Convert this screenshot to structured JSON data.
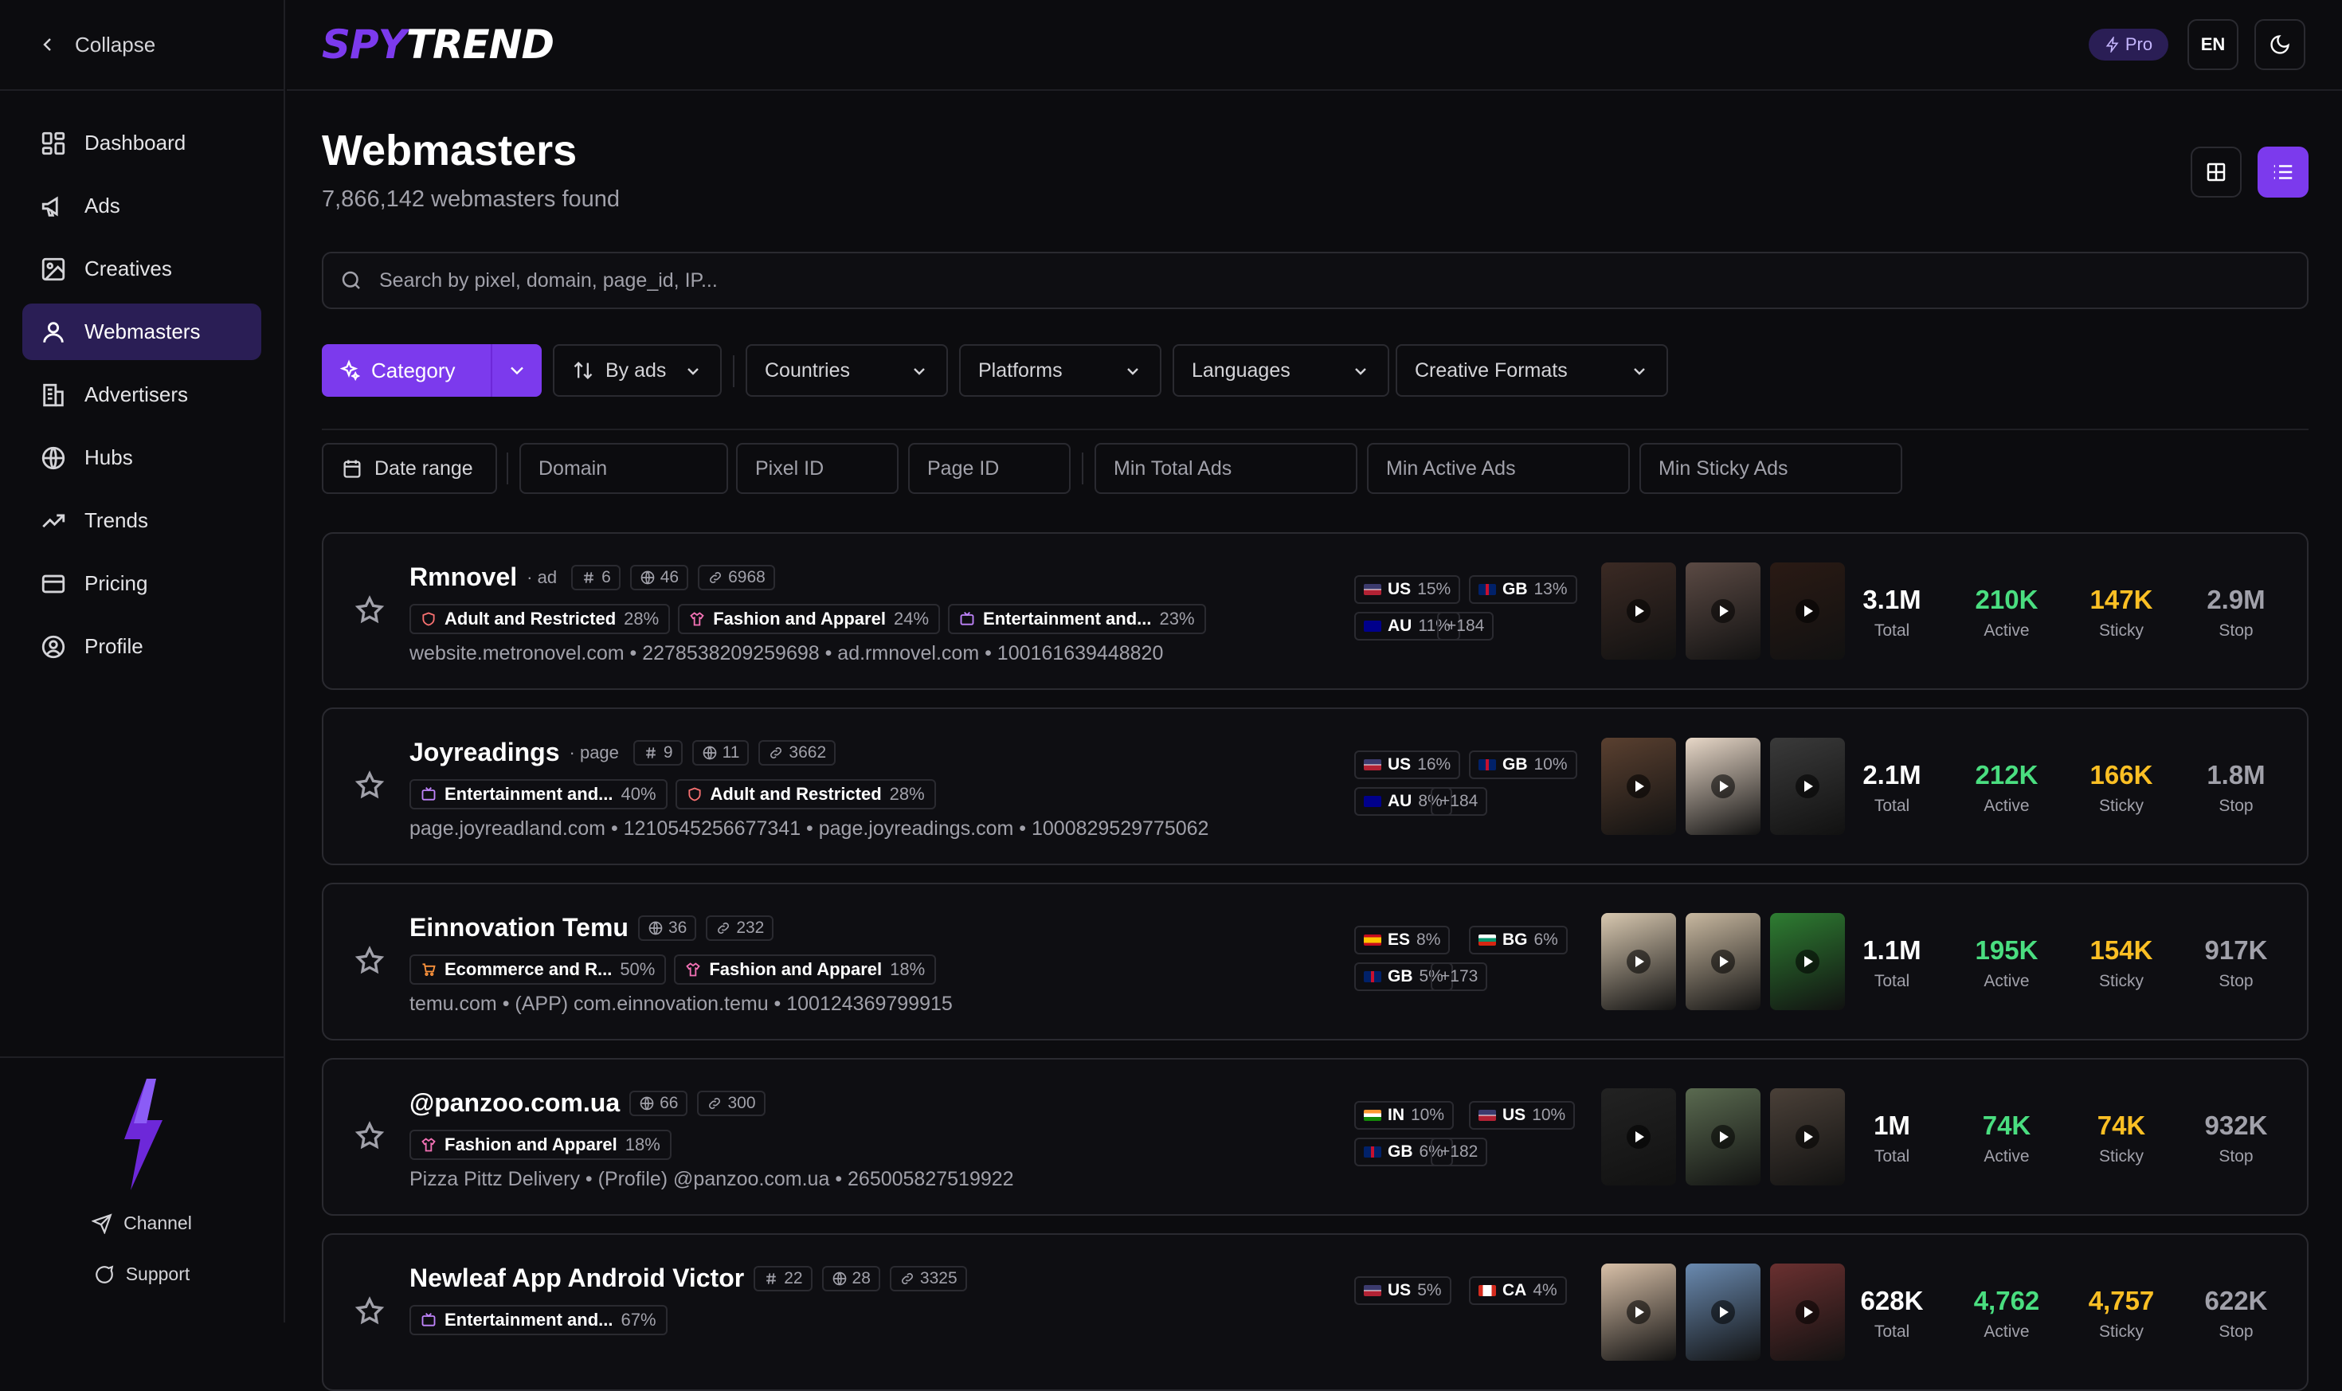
{
  "sidebar": {
    "collapse_label": "Collapse",
    "items": [
      {
        "label": "Dashboard",
        "icon": "dashboard-icon"
      },
      {
        "label": "Ads",
        "icon": "megaphone-icon"
      },
      {
        "label": "Creatives",
        "icon": "image-icon"
      },
      {
        "label": "Webmasters",
        "icon": "user-icon",
        "active": true
      },
      {
        "label": "Advertisers",
        "icon": "building-icon"
      },
      {
        "label": "Hubs",
        "icon": "globe-icon"
      },
      {
        "label": "Trends",
        "icon": "trending-icon"
      },
      {
        "label": "Pricing",
        "icon": "card-icon"
      },
      {
        "label": "Profile",
        "icon": "user-circle-icon"
      }
    ],
    "channel_label": "Channel",
    "support_label": "Support"
  },
  "header": {
    "logo_a": "SPY",
    "logo_b": "TREND",
    "pro_label": "Pro",
    "lang_label": "EN"
  },
  "page": {
    "title": "Webmasters",
    "subtitle": "7,866,142 webmasters found",
    "search_placeholder": "Search by pixel, domain, page_id, IP..."
  },
  "filters": {
    "category": "Category",
    "sort": "By ads",
    "countries": "Countries",
    "platforms": "Platforms",
    "languages": "Languages",
    "formats": "Creative Formats",
    "date_range": "Date range",
    "domain_ph": "Domain",
    "pixel_ph": "Pixel ID",
    "page_ph": "Page ID",
    "min_total_ph": "Min Total Ads",
    "min_active_ph": "Min Active Ads",
    "min_sticky_ph": "Min Sticky Ads"
  },
  "metric_labels": {
    "total": "Total",
    "active": "Active",
    "sticky": "Sticky",
    "stop": "Stop"
  },
  "colors": {
    "accent": "#7c3aed",
    "active": "#4ade80",
    "sticky": "#fbbf24",
    "stop": "#a1a1aa"
  },
  "cards": [
    {
      "name": "Rmnovel",
      "type": "· ad",
      "stats": [
        {
          "icon": "hash-icon",
          "v": "6"
        },
        {
          "icon": "globe-icon",
          "v": "46"
        },
        {
          "icon": "link-icon",
          "v": "6968"
        }
      ],
      "tags": [
        {
          "icon": "shield-icon",
          "label": "Adult and Restricted",
          "pct": "28%",
          "color": "#f87171"
        },
        {
          "icon": "shirt-icon",
          "label": "Fashion and Apparel",
          "pct": "24%",
          "color": "#f472b6"
        },
        {
          "icon": "tv-icon",
          "label": "Entertainment and...",
          "pct": "23%",
          "color": "#c084fc"
        }
      ],
      "meta": "website.metronovel.com • 2278538209259698 • ad.rmnovel.com • 100161639448820",
      "geo": [
        {
          "c": "US",
          "p": "15%"
        },
        {
          "c": "GB",
          "p": "13%"
        },
        {
          "c": "AU",
          "p": "11%"
        }
      ],
      "more": "+184",
      "total": "3.1M",
      "active": "210K",
      "sticky": "147K",
      "stop": "2.9M"
    },
    {
      "name": "Joyreadings",
      "type": "· page",
      "stats": [
        {
          "icon": "hash-icon",
          "v": "9"
        },
        {
          "icon": "globe-icon",
          "v": "11"
        },
        {
          "icon": "link-icon",
          "v": "3662"
        }
      ],
      "tags": [
        {
          "icon": "tv-icon",
          "label": "Entertainment and...",
          "pct": "40%",
          "color": "#c084fc"
        },
        {
          "icon": "shield-icon",
          "label": "Adult and Restricted",
          "pct": "28%",
          "color": "#f87171"
        }
      ],
      "meta": "page.joyreadland.com • 1210545256677341 • page.joyreadings.com • 1000829529775062",
      "geo": [
        {
          "c": "US",
          "p": "16%"
        },
        {
          "c": "GB",
          "p": "10%"
        },
        {
          "c": "AU",
          "p": "8%"
        }
      ],
      "more": "+184",
      "total": "2.1M",
      "active": "212K",
      "sticky": "166K",
      "stop": "1.8M"
    },
    {
      "name": "Einnovation Temu",
      "type": "",
      "stats": [
        {
          "icon": "globe-icon",
          "v": "36"
        },
        {
          "icon": "link-icon",
          "v": "232"
        }
      ],
      "tags": [
        {
          "icon": "cart-icon",
          "label": "Ecommerce and R...",
          "pct": "50%",
          "color": "#fb923c"
        },
        {
          "icon": "shirt-icon",
          "label": "Fashion and Apparel",
          "pct": "18%",
          "color": "#f472b6"
        }
      ],
      "meta": "temu.com • (APP) com.einnovation.temu • 100124369799915",
      "geo": [
        {
          "c": "ES",
          "p": "8%"
        },
        {
          "c": "BG",
          "p": "6%"
        },
        {
          "c": "GB",
          "p": "5%"
        }
      ],
      "more": "+173",
      "total": "1.1M",
      "active": "195K",
      "sticky": "154K",
      "stop": "917K"
    },
    {
      "name": "@panzoo.com.ua",
      "type": "",
      "stats": [
        {
          "icon": "globe-icon",
          "v": "66"
        },
        {
          "icon": "link-icon",
          "v": "300"
        }
      ],
      "tags": [
        {
          "icon": "shirt-icon",
          "label": "Fashion and Apparel",
          "pct": "18%",
          "color": "#f472b6"
        }
      ],
      "meta": "Pizza Pittz Delivery • (Profile) @panzoo.com.ua • 265005827519922",
      "geo": [
        {
          "c": "IN",
          "p": "10%"
        },
        {
          "c": "US",
          "p": "10%"
        },
        {
          "c": "GB",
          "p": "6%"
        }
      ],
      "more": "+182",
      "total": "1M",
      "active": "74K",
      "sticky": "74K",
      "stop": "932K"
    },
    {
      "name": "Newleaf App Android Victor",
      "type": "",
      "stats": [
        {
          "icon": "hash-icon",
          "v": "22"
        },
        {
          "icon": "globe-icon",
          "v": "28"
        },
        {
          "icon": "link-icon",
          "v": "3325"
        }
      ],
      "tags": [
        {
          "icon": "tv-icon",
          "label": "Entertainment and...",
          "pct": "67%",
          "color": "#c084fc"
        }
      ],
      "meta": "",
      "geo": [
        {
          "c": "US",
          "p": "5%"
        },
        {
          "c": "CA",
          "p": "4%"
        }
      ],
      "more": "",
      "total": "628K",
      "active": "4,762",
      "sticky": "4,757",
      "stop": "622K"
    }
  ]
}
